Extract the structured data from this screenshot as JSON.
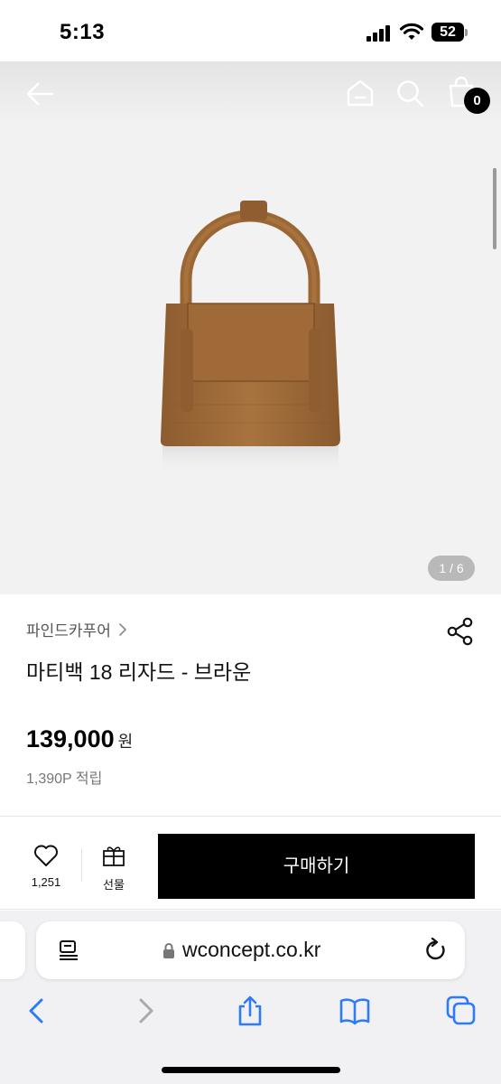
{
  "status_bar": {
    "time": "5:13",
    "battery": "52"
  },
  "nav": {
    "cart_count": "0"
  },
  "product_image": {
    "counter": "1 / 6",
    "bag_color": "#a8733f"
  },
  "product": {
    "brand": "파인드카푸어",
    "title": "마티백 18 리자드 - 브라운",
    "price": "139,000",
    "price_unit": "원",
    "points": "1,390P 적립"
  },
  "actions": {
    "like_count": "1,251",
    "gift_label": "선물",
    "buy_label": "구매하기"
  },
  "browser": {
    "url": "wconcept.co.kr",
    "accent_color": "#2f7bf5"
  },
  "icons": [
    "back-arrow-icon",
    "home-icon",
    "search-icon",
    "shopping-bag-icon",
    "share-icon",
    "chevron-right-icon",
    "heart-icon",
    "gift-icon",
    "reader-icon",
    "lock-icon",
    "reload-icon",
    "back-icon",
    "forward-icon",
    "share-up-icon",
    "bookmarks-icon",
    "tabs-icon"
  ]
}
